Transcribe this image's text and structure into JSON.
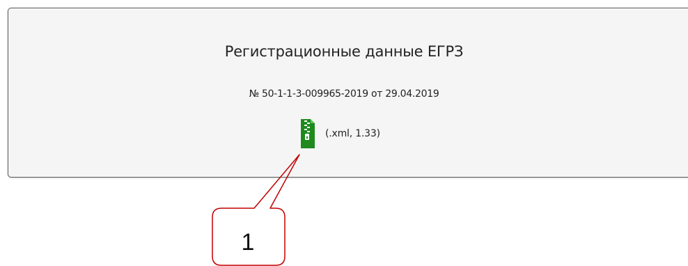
{
  "card": {
    "title": "Регистрационные данные ЕГРЗ",
    "registration_number": "№ 50-1-1-3-009965-2019 от 29.04.2019",
    "file": {
      "icon": "zip-file-icon",
      "meta": "(.xml, 1.33)",
      "icon_color": "#1e8a1e"
    }
  },
  "callout": {
    "label": "1",
    "color": "#c00000"
  }
}
